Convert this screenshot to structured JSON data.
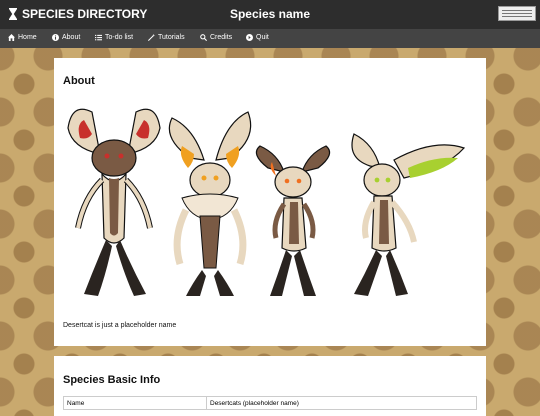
{
  "header": {
    "app_title": "SPECIES DIRECTORY",
    "page_title": "Species name"
  },
  "nav": [
    {
      "label": "Home",
      "icon": "home-icon"
    },
    {
      "label": "About",
      "icon": "info-icon"
    },
    {
      "label": "To-do list",
      "icon": "list-icon"
    },
    {
      "label": "Tutorials",
      "icon": "wand-icon"
    },
    {
      "label": "Credits",
      "icon": "search-icon"
    },
    {
      "label": "Quit",
      "icon": "exit-icon"
    }
  ],
  "about": {
    "heading": "About",
    "caption": "Desertcat is just a placeholder name"
  },
  "basic_info": {
    "heading": "Species Basic Info",
    "rows": [
      {
        "label": "Name",
        "value": "Desertcats (placeholder name)"
      }
    ]
  },
  "colors": {
    "topbar": "#2d2d2d",
    "navbar": "#444444",
    "background": "#c9a96e",
    "fur_brown": "#7a5a44",
    "fur_cream": "#e8d8bf",
    "legs": "#2a2420",
    "ear_red": "#c8302c",
    "ear_orange": "#f0a020",
    "ear_green": "#a8d030"
  }
}
